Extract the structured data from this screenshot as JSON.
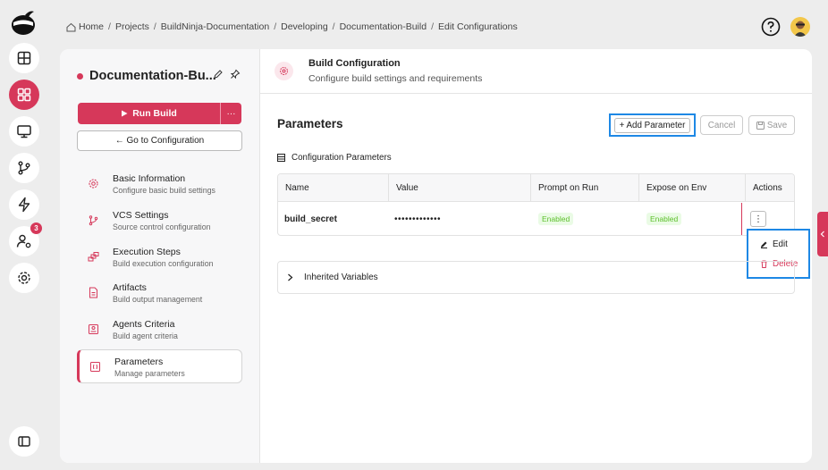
{
  "breadcrumb": [
    "Home",
    "Projects",
    "BuildNinja-Documentation",
    "Developing",
    "Documentation-Build",
    "Edit Configurations"
  ],
  "rail": {
    "badge_count": "3"
  },
  "build": {
    "name": "Documentation-Bu...",
    "run_label": "Run Build",
    "more_label": "···",
    "goto_label": "← Go to Configuration"
  },
  "nav": [
    {
      "title": "Basic Information",
      "sub": "Configure basic build settings",
      "icon": "gear-icon"
    },
    {
      "title": "VCS Settings",
      "sub": "Source control configuration",
      "icon": "git-branch-icon"
    },
    {
      "title": "Execution Steps",
      "sub": "Build execution configuration",
      "icon": "steps-icon"
    },
    {
      "title": "Artifacts",
      "sub": "Build output management",
      "icon": "file-icon"
    },
    {
      "title": "Agents Criteria",
      "sub": "Build agent criteria",
      "icon": "agent-icon"
    },
    {
      "title": "Parameters",
      "sub": "Manage parameters",
      "icon": "parameters-icon"
    }
  ],
  "header": {
    "title": "Build Configuration",
    "subtitle": "Configure build settings and requirements"
  },
  "params": {
    "title": "Parameters",
    "add_label": "Add Parameter",
    "cancel_label": "Cancel",
    "save_label": "Save",
    "section_label": "Configuration Parameters",
    "columns": [
      "Name",
      "Value",
      "Prompt on Run",
      "Expose on Env",
      "Actions"
    ],
    "rows": [
      {
        "name": "build_secret",
        "value": "•••••••••••••",
        "prompt": "Enabled",
        "expose": "Enabled"
      }
    ],
    "menu": {
      "edit": "Edit",
      "delete": "Delete"
    },
    "inherited_label": "Inherited Variables"
  },
  "colors": {
    "accent": "#d6385a",
    "highlight": "#1e88e5",
    "enabled": "#5cbf2a"
  }
}
